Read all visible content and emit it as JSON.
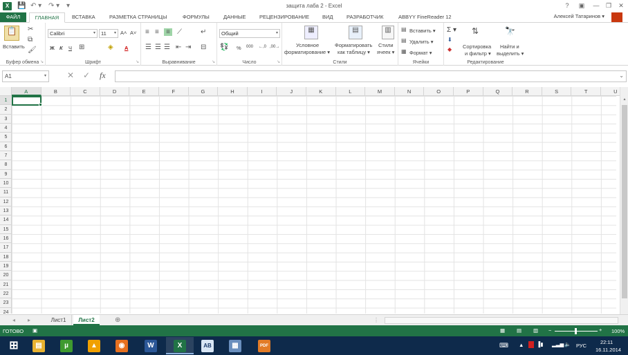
{
  "window": {
    "title": "защита лаба 2 - Excel",
    "logo": "X",
    "help": "?",
    "ribbon_opts": "▣",
    "minimize": "—",
    "restore": "❐",
    "close": "✕"
  },
  "quick_access": {
    "save": "💾",
    "undo": "↶ ▾",
    "redo": "↷ ▾",
    "customize": "▾"
  },
  "tabs": [
    "ФАЙЛ",
    "ГЛАВНАЯ",
    "ВСТАВКА",
    "РАЗМЕТКА СТРАНИЦЫ",
    "ФОРМУЛЫ",
    "ДАННЫЕ",
    "РЕЦЕНЗИРОВАНИЕ",
    "ВИД",
    "РАЗРАБОТЧИК",
    "ABBYY FineReader 12"
  ],
  "user": "Алексей Татаринов ▾",
  "ribbon": {
    "clipboard": {
      "paste": "Вставить",
      "label": "Буфер обмена"
    },
    "font": {
      "name": "Calibri",
      "size": "11",
      "bold": "Ж",
      "italic": "К",
      "underline": "Ч",
      "grow": "A˄",
      "shrink": "A˅",
      "fill_a": "A",
      "label": "Шрифт"
    },
    "alignment": {
      "label": "Выравнивание"
    },
    "number": {
      "format": "Общий",
      "percent": "%",
      "thousands": "000",
      "inc": "←,0",
      "dec": ",00→",
      "label": "Число"
    },
    "styles": {
      "conditional": "Условное",
      "conditional2": "форматирование ▾",
      "as_table": "Форматировать",
      "as_table2": "как таблицу ▾",
      "cell_styles": "Стили",
      "cell_styles2": "ячеек ▾",
      "label": "Стили"
    },
    "cells": {
      "insert": "Вставить ▾",
      "delete": "Удалить ▾",
      "format": "Формат ▾",
      "label": "Ячейки"
    },
    "editing": {
      "sort": "Сортировка",
      "sort2": "и фильтр ▾",
      "find": "Найти и",
      "find2": "выделить ▾",
      "sigma": "Σ ▾",
      "label": "Редактирование"
    }
  },
  "formula_bar": {
    "name_box": "A1",
    "fx": "fx",
    "cancel": "✕",
    "enter": "✓",
    "value": ""
  },
  "columns": [
    "A",
    "B",
    "C",
    "D",
    "E",
    "F",
    "G",
    "H",
    "I",
    "J",
    "K",
    "L",
    "M",
    "N",
    "O",
    "P",
    "Q",
    "R",
    "S",
    "T",
    "U"
  ],
  "rows": [
    "1",
    "2",
    "3",
    "4",
    "5",
    "6",
    "7",
    "8",
    "9",
    "10",
    "11",
    "12",
    "13",
    "14",
    "15",
    "16",
    "17",
    "18",
    "19",
    "20",
    "21",
    "22",
    "23",
    "24"
  ],
  "sheets": {
    "prev": "◂",
    "next": "▸",
    "tab1": "Лист1",
    "tab2": "Лист2",
    "add": "⊕"
  },
  "status": {
    "ready": "ГОТОВО",
    "zoom": "100%"
  },
  "tray": {
    "lang": "РУС",
    "time": "22:11",
    "date": "16.11.2014"
  },
  "taskbar_items": [
    {
      "name": "windows-start",
      "glyph": "⊞",
      "color": "#0e2a4b"
    },
    {
      "name": "file-explorer",
      "glyph": "▤",
      "color": "#e8b230"
    },
    {
      "name": "utorrent",
      "glyph": "µ",
      "color": "#3f9a2f"
    },
    {
      "name": "aimp",
      "glyph": "▲",
      "color": "#f0a000"
    },
    {
      "name": "firefox",
      "glyph": "◉",
      "color": "#e6701f"
    },
    {
      "name": "word",
      "glyph": "W",
      "color": "#2b5797"
    },
    {
      "name": "excel",
      "glyph": "X",
      "color": "#217346"
    },
    {
      "name": "abbyy",
      "glyph": "AB",
      "color": "#d8e6f5"
    },
    {
      "name": "calculator",
      "glyph": "▦",
      "color": "#6a8fbe"
    },
    {
      "name": "pdf",
      "glyph": "PDF",
      "color": "#e27b26"
    }
  ]
}
